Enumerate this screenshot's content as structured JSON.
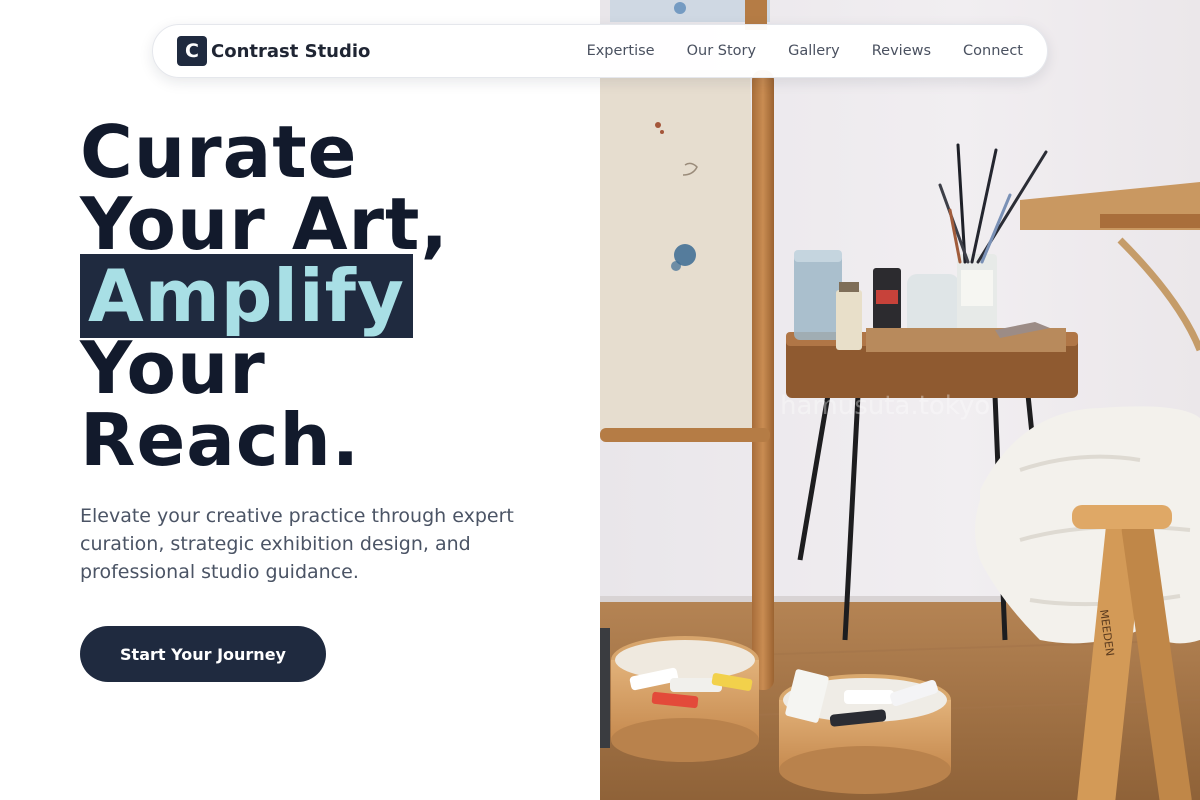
{
  "brand": {
    "logo_letter": "C",
    "name": "Contrast Studio"
  },
  "nav": {
    "items": [
      "Expertise",
      "Our Story",
      "Gallery",
      "Reviews",
      "Connect"
    ]
  },
  "hero": {
    "lines": [
      "Curate",
      "Your Art,",
      "Amplify",
      "Your",
      "Reach."
    ],
    "subtitle": "Elevate your creative practice through expert curation, strategic exhibition design, and professional studio guidance.",
    "cta_label": "Start Your Journey"
  },
  "photo": {
    "watermark": "hamusuta.tokyo",
    "easel_brand": "MEEDEN"
  },
  "colors": {
    "primary": "#1f2a3f",
    "highlight_text": "#a8dfe5",
    "headline": "#121a2c",
    "body": "#4b5465"
  }
}
